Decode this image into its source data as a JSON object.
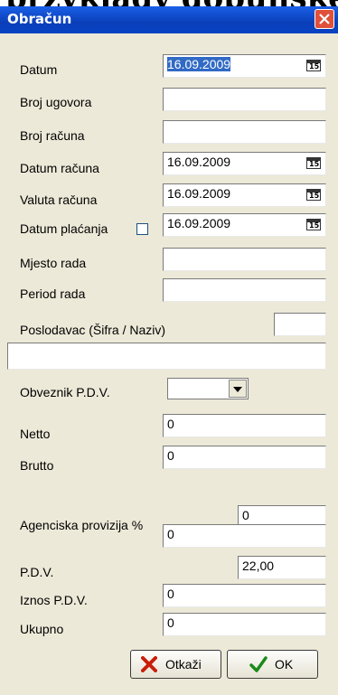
{
  "dialog": {
    "title": "Obračun"
  },
  "form": {
    "datum": {
      "label": "Datum",
      "value": "16.09.2009"
    },
    "broj_ugovora": {
      "label": "Broj ugovora",
      "value": ""
    },
    "broj_racuna": {
      "label": "Broj računa",
      "value": ""
    },
    "datum_racuna": {
      "label": "Datum računa",
      "value": "16.09.2009"
    },
    "valuta_racuna": {
      "label": "Valuta računa",
      "value": "16.09.2009"
    },
    "datum_placanja": {
      "label": "Datum plaćanja",
      "value": "16.09.2009",
      "checked": false
    },
    "mjesto_rada": {
      "label": "Mjesto rada",
      "value": ""
    },
    "period_rada": {
      "label": "Period rada",
      "value": ""
    },
    "poslodavac": {
      "label": "Poslodavac (Šifra / Naziv)",
      "sifra": "",
      "naziv": ""
    },
    "obveznik_pdv": {
      "label": "Obveznik P.D.V.",
      "value": ""
    },
    "netto": {
      "label": "Netto",
      "value": "0"
    },
    "brutto": {
      "label": "Brutto",
      "value": "0"
    },
    "agencijska_provizija": {
      "label": "Agenciska provizija %",
      "value": "0",
      "amount": "0"
    },
    "pdv": {
      "label": "P.D.V.",
      "value": "22,00"
    },
    "iznos_pdv": {
      "label": "Iznos P.D.V.",
      "value": "0"
    },
    "ukupno": {
      "label": "Ukupno",
      "value": "0"
    }
  },
  "calendar_icon_text": "15",
  "buttons": {
    "cancel": "Otkaži",
    "ok": "OK"
  },
  "colors": {
    "titlebar": "#0a3fb8",
    "close_button": "#e0503a",
    "window_bg": "#ece9d8",
    "selection": "#316ac5"
  }
}
